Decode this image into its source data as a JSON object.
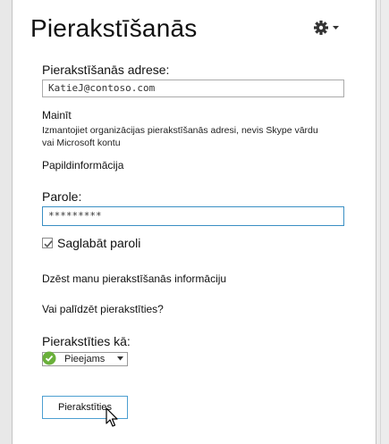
{
  "title": "Pierakstīšanās",
  "signin_address": {
    "label": "Pierakstīšanās adrese:",
    "value": "KatieJ@contoso.com"
  },
  "change": {
    "link": "Mainīt",
    "help_line1": "Izmantojiet organizācijas pierakstīšanās adresi, nevis Skype vārdu",
    "help_line2": "vai Microsoft kontu"
  },
  "more_info": "Papildinformācija",
  "password": {
    "label": "Parole:",
    "value": "*********"
  },
  "save_password": {
    "label": "Saglabāt paroli",
    "checked": true
  },
  "delete_info": "Dzēst manu pierakstīšanās informāciju",
  "help_signin": "Vai palīdzēt pierakstīties?",
  "signin_as": {
    "label": "Pierakstīties kā:",
    "selected": "Pieejams",
    "status_color": "#6ab03b"
  },
  "signin_button": "Pierakstīties",
  "icons": {
    "settings": "gear-icon",
    "settings_menu": "caret-down-icon",
    "checkbox": "checkmark-icon",
    "presence": "available-status-icon",
    "select_arrow": "dropdown-arrow-icon",
    "cursor": "mouse-pointer-icon"
  }
}
